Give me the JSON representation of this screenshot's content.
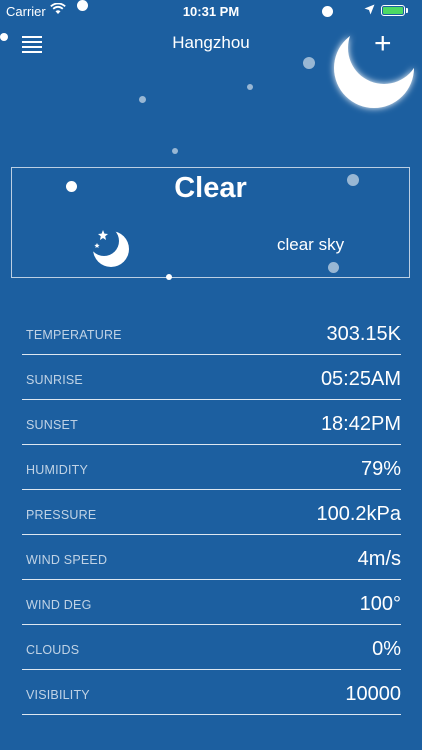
{
  "status_bar": {
    "carrier": "Carrier",
    "time": "10:31 PM"
  },
  "header": {
    "title": "Hangzhou",
    "add_label": "+"
  },
  "summary": {
    "main": "Clear",
    "description": "clear sky"
  },
  "details": [
    {
      "label": "TEMPERATURE",
      "value": "303.15K"
    },
    {
      "label": "SUNRISE",
      "value": "05:25AM"
    },
    {
      "label": "SUNSET",
      "value": "18:42PM"
    },
    {
      "label": "HUMIDITY",
      "value": "79%"
    },
    {
      "label": "PRESSURE",
      "value": "100.2kPa"
    },
    {
      "label": "WIND SPEED",
      "value": "4m/s"
    },
    {
      "label": "WIND DEG",
      "value": "100°"
    },
    {
      "label": "CLOUDS",
      "value": "0%"
    },
    {
      "label": "VISIBILITY",
      "value": "10000"
    }
  ],
  "icons": {
    "menu": "hamburger-menu-icon",
    "add": "plus-icon",
    "weather": "crescent-moon-stars-icon",
    "decor": "crescent-moon-icon"
  },
  "colors": {
    "background": "#1c5fa0",
    "battery": "#4cd964"
  }
}
